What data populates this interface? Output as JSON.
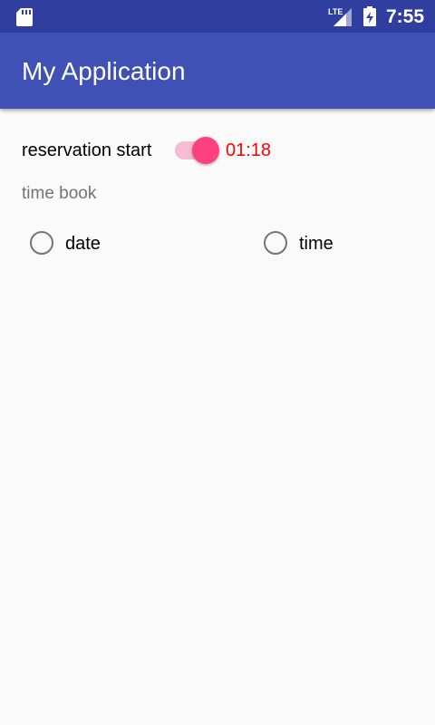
{
  "status_bar": {
    "network_label": "LTE",
    "time": "7:55",
    "icons": [
      "sd-card-icon",
      "lte-signal-icon",
      "battery-charging-icon"
    ],
    "background_color": "#303f9f"
  },
  "app_bar": {
    "title": "My Application",
    "background_color": "#3f51b5"
  },
  "reservation": {
    "switch_label": "reservation start",
    "switch_on": true,
    "timer": "01:18",
    "accent_color": "#ff4081",
    "timer_color": "#ff0000"
  },
  "time_book": {
    "label": "time book",
    "options": [
      {
        "label": "date",
        "checked": false
      },
      {
        "label": "time",
        "checked": false
      }
    ]
  }
}
